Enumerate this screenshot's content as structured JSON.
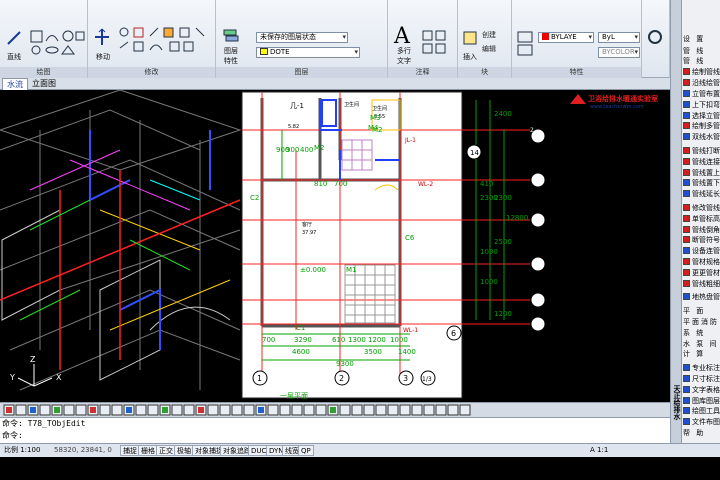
{
  "ribbon": {
    "panels": [
      {
        "title": "绘图"
      },
      {
        "title": "修改"
      },
      {
        "title": "图层"
      },
      {
        "title": "注释"
      },
      {
        "title": "块"
      },
      {
        "title": "特性"
      }
    ],
    "line_label": "直线",
    "move_label": "移动",
    "layer_props_label": "图层\n特性",
    "layer_state_value": "未保存的图层状态",
    "layer_value": "DOTE",
    "multiline_text_label": "多行\n文字",
    "insert_label": "插入",
    "create_label": "创建",
    "edit_label": "编辑",
    "color_value": "BYLAYE",
    "linetype_value": "ByL",
    "lineweight_value": "BYCOLOR"
  },
  "tabs": [
    {
      "label": "水流"
    },
    {
      "label": "立面图"
    }
  ],
  "drawing": {
    "logo_text": "卫浴给排水暖通实验室",
    "logo_url": "www.teacherwm.com",
    "room_label_1": "几-1",
    "room_label_2": "卫生间",
    "room_area_1": "5.82",
    "room_label_3": "卫生间",
    "room_area_3": "3.55",
    "room_label_4": "客厅",
    "room_area_4": "37.97",
    "level_text": "±0.000",
    "dims_vertical": [
      "2400",
      "2300",
      "2500",
      "1200",
      "2300",
      "410",
      "1090",
      "1000",
      "12800"
    ],
    "dims_bottom_1": [
      "700",
      "3290",
      "610",
      "1300",
      "1200",
      "1000"
    ],
    "dims_bottom_2": [
      "4600",
      "3500",
      "1400"
    ],
    "dim_total": "9300",
    "dims_left": [
      "900",
      "900",
      "400",
      "810",
      "700"
    ],
    "grid_letters": [
      "E",
      "E",
      "D",
      "C",
      "B",
      "A",
      "2"
    ],
    "grid_numbers": [
      "1",
      "2",
      "3",
      "1/3",
      "6",
      "14"
    ],
    "door_labels": [
      "M4",
      "M2",
      "M2",
      "M3",
      "M1",
      "C1",
      "C2",
      "C6",
      "M1"
    ],
    "pipe_label_1": "JL-1",
    "pipe_label_2": "WL-1",
    "pipe_label_3": "WL-2",
    "plan_title": "一层平面",
    "axis_x": "X",
    "axis_y": "Y",
    "axis_z": "Z"
  },
  "commandline": {
    "line1": "命令: T78_TObjEdit",
    "line2": "命令:"
  },
  "status": {
    "scale": "比例 1:100",
    "coords": "58320, 23841, 0",
    "toggles": [
      "捕捉",
      "栅格",
      "正交",
      "极轴",
      "对象捕捉",
      "对象追踪",
      "DUCS",
      "DYN",
      "线宽",
      "QP"
    ],
    "zoom": "A 1:1"
  },
  "palette": {
    "title": "天正给排水",
    "items": [
      {
        "label": "设 置",
        "type": "cat"
      },
      {
        "label": "管 线",
        "type": "cat"
      },
      {
        "label": "管 线",
        "type": "cat"
      },
      {
        "label": "绘制管线",
        "type": "item",
        "color": "#d02020"
      },
      {
        "label": "沿线绘管",
        "type": "item",
        "color": "#d02020"
      },
      {
        "label": "立管布置",
        "type": "item",
        "color": "#2050d0"
      },
      {
        "label": "上下扣弯",
        "type": "item",
        "color": "#2050d0"
      },
      {
        "label": "选择立管",
        "type": "item",
        "color": "#2050d0"
      },
      {
        "label": "绘制多管",
        "type": "item",
        "color": "#d02020"
      },
      {
        "label": "双线水管",
        "type": "item",
        "color": "#2050d0"
      },
      {
        "label": "管线打断",
        "type": "item",
        "color": "#d02020"
      },
      {
        "label": "管线连接",
        "type": "item",
        "color": "#d02020"
      },
      {
        "label": "管线置上",
        "type": "item",
        "color": "#d02020"
      },
      {
        "label": "管线置下",
        "type": "item",
        "color": "#2050d0"
      },
      {
        "label": "管线延长",
        "type": "item",
        "color": "#2050d0"
      },
      {
        "label": "修改管线",
        "type": "item",
        "color": "#d02020"
      },
      {
        "label": "单管标高",
        "type": "item",
        "color": "#d02020"
      },
      {
        "label": "管线倒角",
        "type": "item",
        "color": "#d02020"
      },
      {
        "label": "断管符号",
        "type": "item",
        "color": "#d02020"
      },
      {
        "label": "设备连管",
        "type": "item",
        "color": "#2050d0"
      },
      {
        "label": "管材规格",
        "type": "item",
        "color": "#d02020"
      },
      {
        "label": "更更管材",
        "type": "item",
        "color": "#d02020"
      },
      {
        "label": "管线粗细",
        "type": "item",
        "color": "#d02020"
      },
      {
        "label": "地热盘管",
        "type": "item",
        "color": "#2050d0"
      },
      {
        "label": "平 面",
        "type": "cat"
      },
      {
        "label": "平面消防",
        "type": "cat"
      },
      {
        "label": "系 统",
        "type": "cat"
      },
      {
        "label": "水 泵 间",
        "type": "cat"
      },
      {
        "label": "计 算",
        "type": "cat"
      },
      {
        "label": "专业标注",
        "type": "item",
        "color": "#2050d0"
      },
      {
        "label": "尺寸标注",
        "type": "item",
        "color": "#2050d0"
      },
      {
        "label": "文字表格",
        "type": "item",
        "color": "#2050d0"
      },
      {
        "label": "图库图层",
        "type": "item",
        "color": "#2050d0"
      },
      {
        "label": "绘图工具",
        "type": "item",
        "color": "#2050d0"
      },
      {
        "label": "文件布图",
        "type": "item",
        "color": "#2050d0"
      },
      {
        "label": "帮 助",
        "type": "cat"
      }
    ]
  },
  "colors": {
    "canvas_bg": "#000000",
    "plan_bg": "#ffffff",
    "grid_red": "#ff2020",
    "dim_green": "#00a000",
    "wall_gray": "#666666",
    "pipe_blue": "#2040ff"
  }
}
